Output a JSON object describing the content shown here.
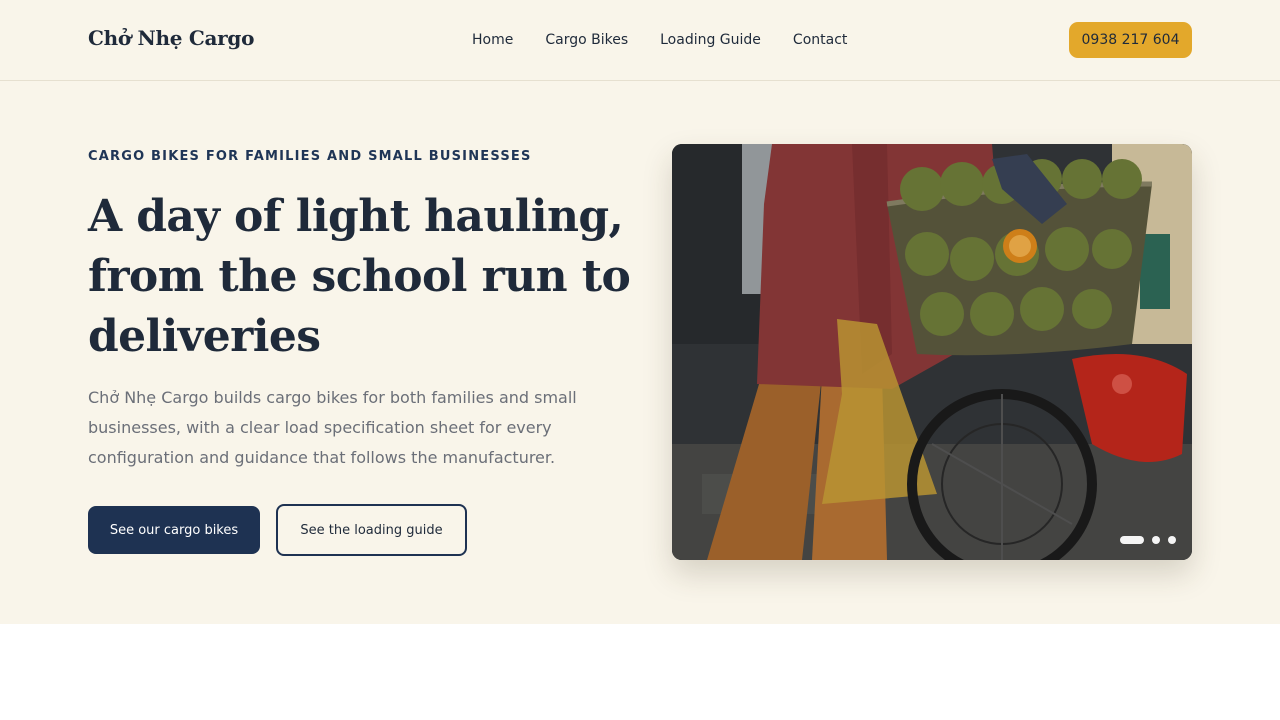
{
  "header": {
    "brand": "Chở Nhẹ Cargo",
    "nav": [
      "Home",
      "Cargo Bikes",
      "Loading Guide",
      "Contact"
    ],
    "phone": "0938 217 604"
  },
  "hero": {
    "eyebrow": "CARGO BIKES FOR FAMILIES AND SMALL BUSINESSES",
    "headline": "A day of light hauling, from the school run to deliveries",
    "intro": "Chở Nhẹ Cargo builds cargo bikes for both families and small businesses, with a clear load specification sheet for every configuration and guidance that follows the manufacturer.",
    "primary_cta": "See our cargo bikes",
    "secondary_cta": "See the loading guide"
  },
  "carousel": {
    "slide_count": 3,
    "active_index": 0
  },
  "colors": {
    "background": "#f9f5ea",
    "navy": "#1e3252",
    "accent": "#e3a82b",
    "muted_text": "#6b6f78"
  }
}
